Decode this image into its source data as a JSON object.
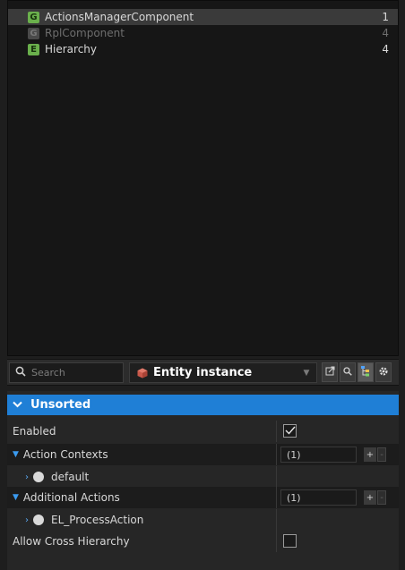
{
  "component_list": {
    "items": [
      {
        "badge": "G",
        "label": "ActionsManagerComponent",
        "count": "1",
        "selected": true,
        "dim": false
      },
      {
        "badge": "G",
        "label": "RplComponent",
        "count": "4",
        "selected": false,
        "dim": true
      },
      {
        "badge": "E",
        "label": "Hierarchy",
        "count": "4",
        "selected": false,
        "dim": false
      }
    ]
  },
  "toolbar": {
    "search_placeholder": "Search",
    "entity_label": "Entity instance"
  },
  "properties": {
    "section_title": "Unsorted",
    "rows": {
      "enabled": {
        "label": "Enabled",
        "checked": true
      },
      "action_contexts": {
        "label": "Action Contexts",
        "count": "(1)"
      },
      "default": {
        "label": "default"
      },
      "additional_actions": {
        "label": "Additional Actions",
        "count": "(1)"
      },
      "el_process_action": {
        "label": "EL_ProcessAction"
      },
      "allow_cross_hierarchy": {
        "label": "Allow Cross Hierarchy",
        "checked": false
      }
    },
    "plus_label": "+",
    "minus_label": "-"
  },
  "colors": {
    "accent": "#1f7fd6",
    "badge_green": "#6ab04c",
    "entity_cube": "#c9584a"
  },
  "icons": [
    "search-icon",
    "entity-cube-icon",
    "dropdown-arrow-icon",
    "open-external-icon",
    "find-icon",
    "hierarchy-icon",
    "gear-icon",
    "chevron-down-icon",
    "expand-arrow-icon",
    "circle-icon",
    "check-icon"
  ]
}
